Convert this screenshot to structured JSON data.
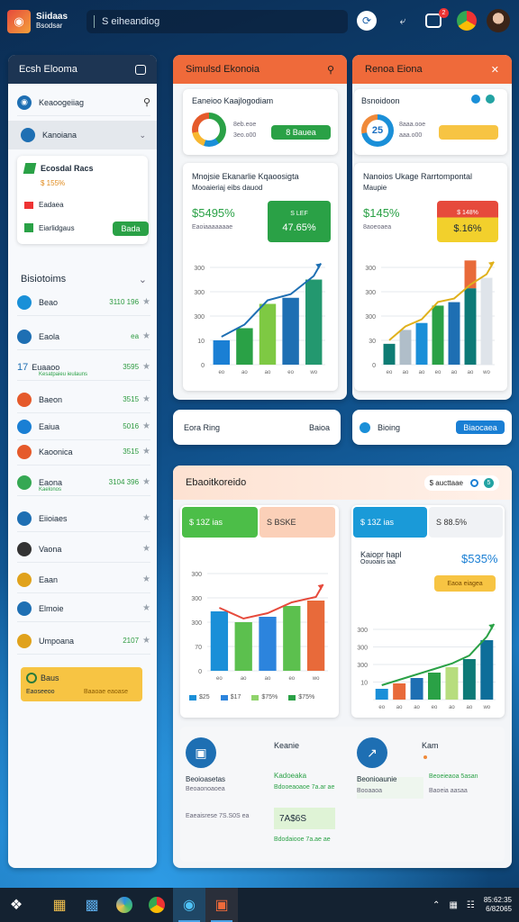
{
  "app": {
    "title_line1": "Siidaas",
    "title_line2": "Bsodsar",
    "search_text": "S eiheandiog"
  },
  "topbar_icons": [
    "sync-icon",
    "share-icon",
    "notification-icon",
    "chrome-icon",
    "avatar"
  ],
  "notification_count": "2",
  "sidebar": {
    "header": "Ecsh Elooma",
    "search_label": "Keaoogeiiag",
    "selected_label": "Kanoiana",
    "card": {
      "title": "Ecosdal Racs",
      "value": "$ 155%",
      "row1": "Eadaea",
      "row2": "Eiarlidgaus",
      "button": "Bada"
    },
    "section_title": "Bisiotoims",
    "items": [
      {
        "label": "Beao",
        "value": "3110 196",
        "color": "#1a90d8"
      },
      {
        "label": "Eaola",
        "value": "ea",
        "color": "#1e6fb3"
      },
      {
        "label": "Euaaoo",
        "value": "3595",
        "color": "#1e6fb3",
        "big": "17",
        "sub": "Kesatpaieu ieulauns"
      },
      {
        "label": "Baeon",
        "value": "3515",
        "color": "#e55a2b"
      },
      {
        "label": "Eaiua",
        "value": "5016",
        "color": "#1a7fd4"
      },
      {
        "label": "Kaoonica",
        "value": "3515",
        "color": "#e55a2b"
      },
      {
        "label": "Eaona",
        "value": "3104 396",
        "color": "#35a853",
        "sub": "Kaelonos"
      },
      {
        "label": "Eiioiaes",
        "value": "",
        "color": "#1e6fb3"
      },
      {
        "label": "Vaona",
        "value": "",
        "color": "#333"
      },
      {
        "label": "Eaan",
        "value": "",
        "color": "#e0a21c"
      },
      {
        "label": "Elmoie",
        "value": "",
        "color": "#1e6fb3"
      },
      {
        "label": "Umpoana",
        "value": "2107",
        "color": "#e0a21c"
      }
    ],
    "footer_card": {
      "title": "Baus",
      "subtitle": "Eaoseeoo",
      "value": "Baaoae eaoase"
    }
  },
  "left_pane": {
    "title": "Simulsd Ekonoia",
    "kpi_card": {
      "title": "Eaneioo Kaajlogodiam",
      "line1": "8eb.eoe",
      "line2": "3eo.o00",
      "button": "8 Bauea"
    },
    "chart_card": {
      "title": "Mnojsie Ekanarlie Kqaoosigta",
      "subtitle": "Mooaieriaj eibs dauod",
      "metric": "$5495%",
      "metric_sub": "Eaoiaaaaaaae",
      "badge_top": "S LEF",
      "badge_value": "47.65%"
    }
  },
  "right_pane": {
    "title": "Renoa Eiona",
    "kpi_card": {
      "title": "Bsnoidoon",
      "ring_value": "25",
      "line1": "8aaa.ooe",
      "line2": "aaa.o00"
    },
    "chart_card": {
      "title": "Nanoios Ukage Rarrtompontal",
      "subtitle": "Maupie",
      "metric": "$145%",
      "metric_sub": "8aoeoaea",
      "badge_top": "$ 148%",
      "badge_value": "$.16%"
    }
  },
  "strip_left": {
    "label": "Eora Ring",
    "value": "Baioa"
  },
  "strip_right": {
    "label": "Bioing",
    "button": "Biaocaea"
  },
  "bottom_pane": {
    "title": "Ebaoitkoreido",
    "tag": "$ aucttaae",
    "tag_count": "5",
    "chart1": {
      "pill1": "$ 13Z ias",
      "pill2": "S BSKE",
      "legend": [
        "$25",
        "$17",
        "$75%",
        "$75%"
      ]
    },
    "chart2": {
      "pill1": "$ 13Z ias",
      "pill2": "S 88.5%",
      "title": "Kaiopr hapl",
      "subtitle": "Oouoaiis iaa",
      "metric": "$535%",
      "button": "Eaoa eiagea"
    },
    "info1": {
      "title": "Keanie",
      "l1": "Beoioasetas",
      "l2": "Beoaonoaoea",
      "l3": "Eaeaisrese 7S.S0S ea",
      "g1": "Kadoeaka",
      "g2": "Bdooeaoaoe 7a.ar ae",
      "boxval": "7A$6S",
      "g3": "Bdodaiooe 7a.ae ae"
    },
    "info2": {
      "title": "Kam",
      "l1": "Beonioaunie",
      "l2": "Booaaoa",
      "g1": "Beoeieaoa 5asan",
      "g2": "Baoeia aasaa"
    }
  },
  "taskbar": {
    "time": "85:62:35",
    "date": "6/82065"
  },
  "chart_data": [
    {
      "type": "bar",
      "categories": [
        "a",
        "b",
        "c",
        "d",
        "e"
      ],
      "values": [
        8,
        12,
        20,
        22,
        28
      ],
      "ylim": [
        0,
        32
      ],
      "yticks": [
        0,
        10,
        20,
        300,
        300,
        300
      ],
      "colors": [
        "#1a7fd4",
        "#2aa146",
        "#7ec943",
        "#1e6fb3",
        "#23986f",
        "#7ed356"
      ],
      "extra": [
        0,
        0,
        0,
        0,
        0
      ]
    },
    {
      "type": "bar",
      "categories": [
        "a",
        "b",
        "c",
        "d",
        "e",
        "f",
        "g"
      ],
      "values": [
        6,
        10,
        12,
        17,
        18,
        22,
        25
      ],
      "ylim": [
        0,
        28
      ],
      "colors": [
        "#0e7c74",
        "#b0bec9",
        "#1a8fd8",
        "#2aa146",
        "#1e6fb3",
        "#0d7a77",
        "#dfe4ea"
      ],
      "tops": [
        0,
        0,
        0,
        0,
        0,
        8,
        0
      ]
    },
    {
      "type": "bar",
      "categories": [
        "a",
        "b",
        "c",
        "d",
        "e"
      ],
      "values": [
        22,
        18,
        20,
        24,
        26
      ],
      "ylim": [
        0,
        36
      ],
      "colors": [
        "#1a8fd8",
        "#5cc04e",
        "#2c84dd",
        "#5cc04e",
        "#e86a3a"
      ]
    },
    {
      "type": "bar",
      "categories": [
        "a",
        "b",
        "c",
        "d",
        "e",
        "f",
        "g"
      ],
      "values": [
        4,
        6,
        8,
        10,
        12,
        15,
        22
      ],
      "ylim": [
        0,
        26
      ],
      "colors": [
        "#1a8fd8",
        "#e86a3a",
        "#1e6fb3",
        "#2aa146",
        "#b7dd7e",
        "#0d7a77",
        "#0e6e9a"
      ]
    }
  ]
}
